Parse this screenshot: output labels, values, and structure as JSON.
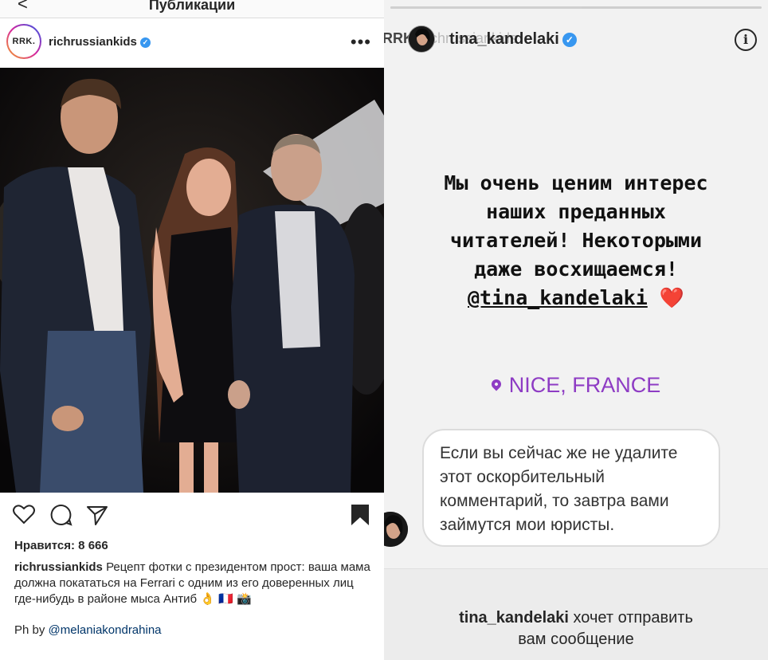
{
  "left": {
    "top_bar": {
      "back_label": "<",
      "title": "Публикации"
    },
    "post": {
      "username": "richrussiankids",
      "avatar_text": "RRK.",
      "more_label": "•••",
      "likes": "Нравится: 8 666",
      "caption_user": "richrussiankids",
      "caption_text": "Рецепт фотки с президентом прост: ваша мама должна покататься на Ferrari с одним из его доверенных лиц где-нибудь в районе мыса Антиб 👌 🇫🇷 📸",
      "credit_prefix": "Ph by",
      "credit_mention": "@melaniakondrahina"
    },
    "icons": {
      "like": "heart-outline-icon",
      "comment": "comment-bubble-icon",
      "share": "paper-plane-icon",
      "save": "bookmark-filled-icon"
    }
  },
  "right": {
    "ghost_avatar_text": "RRK.",
    "ghost_username": "richrussiankids",
    "story_username": "tina_kandelaki",
    "info_label": "i",
    "story_lines": [
      "Мы очень ценим интерес",
      "наших преданных",
      "читателей! Некоторыми",
      "даже восхищаемся!"
    ],
    "story_mention": "@tina_kandelaki",
    "heart_emoji": "❤️",
    "location": "NICE, FRANCE",
    "bubble_text": "Если вы сейчас же не удалите этот оскорбительный комментарий, то завтра вами займутся мои юристы.",
    "message_user": "tina_kandelaki",
    "message_line1_rest": "хочет отправить",
    "message_line2": "вам сообщение"
  },
  "colors": {
    "verified": "#3897f0",
    "location": "#8e3cc4",
    "mention_link": "#003569",
    "heart": "#e0245e"
  }
}
